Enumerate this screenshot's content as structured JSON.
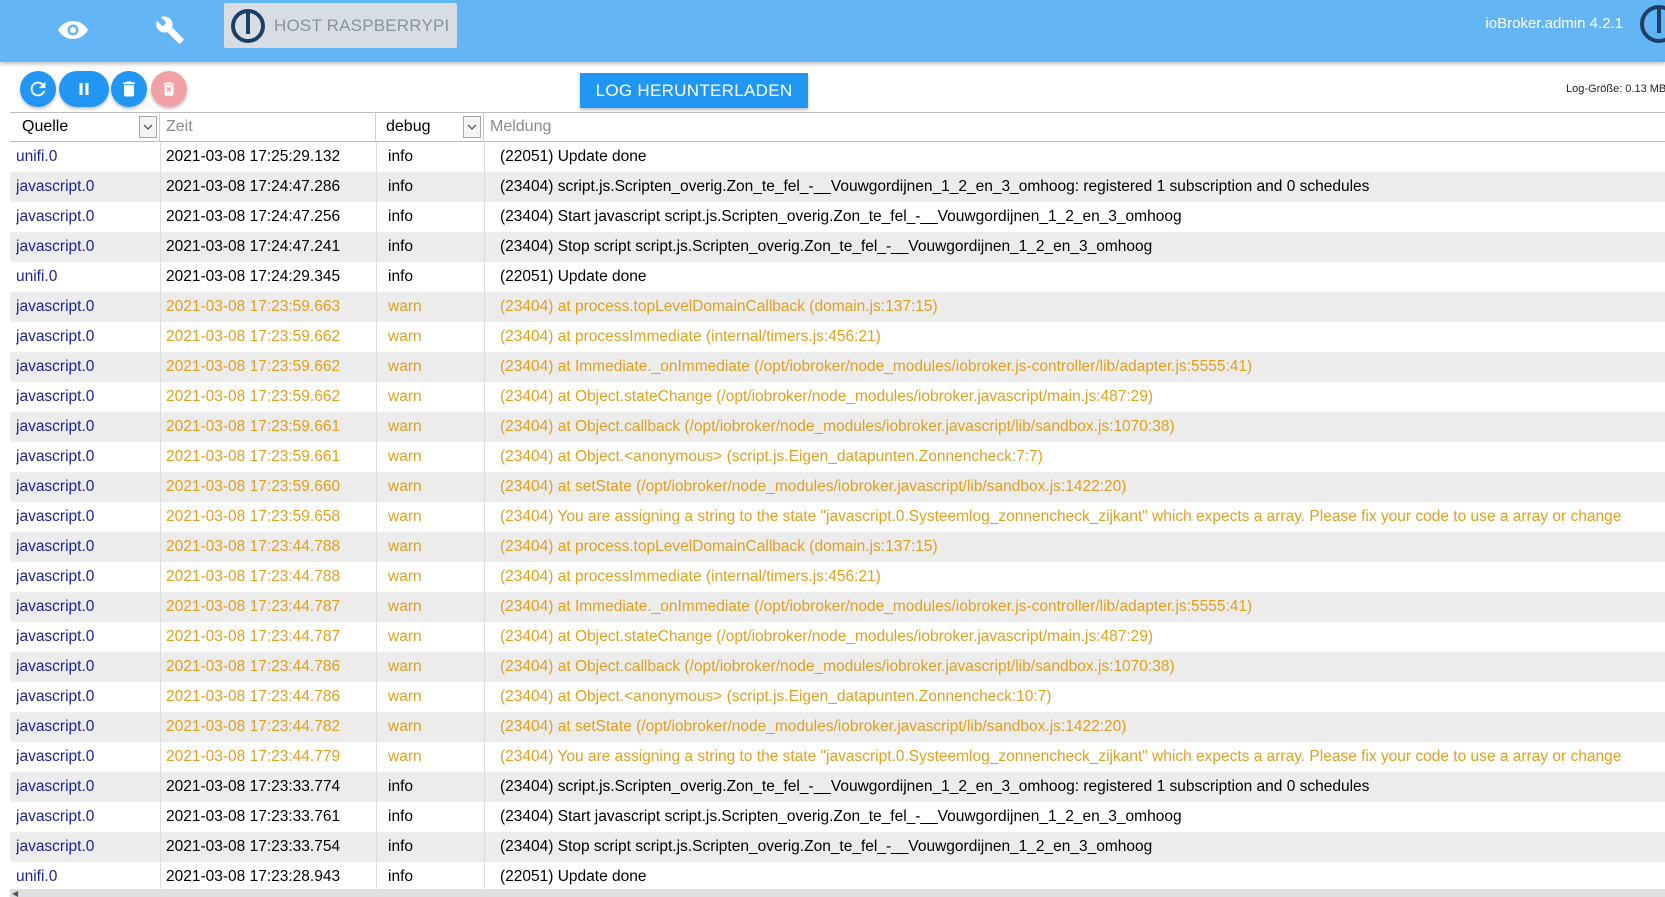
{
  "header": {
    "host_label": "HOST RASPBERRYPI",
    "version": "ioBroker.admin 4.2.1"
  },
  "toolbar": {
    "download_label": "LOG HERUNTERLADEN",
    "log_size": "Log-Größe: 0.13 MB"
  },
  "columns": {
    "source": "Quelle",
    "time": "Zeit",
    "severity": "debug",
    "message_placeholder": "Meldung"
  },
  "colors": {
    "topbar": "#64b5f6",
    "accent": "#2196f3",
    "warn": "#e0a020",
    "source_text": "#1b1f9a"
  },
  "rows": [
    {
      "source": "unifi.0",
      "time": "2021-03-08 17:25:29.132",
      "severity": "info",
      "message": "(22051) Update done"
    },
    {
      "source": "javascript.0",
      "time": "2021-03-08 17:24:47.286",
      "severity": "info",
      "message": "(23404) script.js.Scripten_overig.Zon_te_fel_-__Vouwgordijnen_1_2_en_3_omhoog: registered 1 subscription and 0 schedules"
    },
    {
      "source": "javascript.0",
      "time": "2021-03-08 17:24:47.256",
      "severity": "info",
      "message": "(23404) Start javascript script.js.Scripten_overig.Zon_te_fel_-__Vouwgordijnen_1_2_en_3_omhoog"
    },
    {
      "source": "javascript.0",
      "time": "2021-03-08 17:24:47.241",
      "severity": "info",
      "message": "(23404) Stop script script.js.Scripten_overig.Zon_te_fel_-__Vouwgordijnen_1_2_en_3_omhoog"
    },
    {
      "source": "unifi.0",
      "time": "2021-03-08 17:24:29.345",
      "severity": "info",
      "message": "(22051) Update done"
    },
    {
      "source": "javascript.0",
      "time": "2021-03-08 17:23:59.663",
      "severity": "warn",
      "message": "(23404) at process.topLevelDomainCallback (domain.js:137:15)"
    },
    {
      "source": "javascript.0",
      "time": "2021-03-08 17:23:59.662",
      "severity": "warn",
      "message": "(23404) at processImmediate (internal/timers.js:456:21)"
    },
    {
      "source": "javascript.0",
      "time": "2021-03-08 17:23:59.662",
      "severity": "warn",
      "message": "(23404) at Immediate._onImmediate (/opt/iobroker/node_modules/iobroker.js-controller/lib/adapter.js:5555:41)"
    },
    {
      "source": "javascript.0",
      "time": "2021-03-08 17:23:59.662",
      "severity": "warn",
      "message": "(23404) at Object.stateChange (/opt/iobroker/node_modules/iobroker.javascript/main.js:487:29)"
    },
    {
      "source": "javascript.0",
      "time": "2021-03-08 17:23:59.661",
      "severity": "warn",
      "message": "(23404) at Object.callback (/opt/iobroker/node_modules/iobroker.javascript/lib/sandbox.js:1070:38)"
    },
    {
      "source": "javascript.0",
      "time": "2021-03-08 17:23:59.661",
      "severity": "warn",
      "message": "(23404) at Object.<anonymous> (script.js.Eigen_datapunten.Zonnencheck:7:7)"
    },
    {
      "source": "javascript.0",
      "time": "2021-03-08 17:23:59.660",
      "severity": "warn",
      "message": "(23404) at setState (/opt/iobroker/node_modules/iobroker.javascript/lib/sandbox.js:1422:20)"
    },
    {
      "source": "javascript.0",
      "time": "2021-03-08 17:23:59.658",
      "severity": "warn",
      "message": "(23404) You are assigning a string to the state \"javascript.0.Systeemlog_zonnencheck_zijkant\" which expects a array. Please fix your code to use a array or change"
    },
    {
      "source": "javascript.0",
      "time": "2021-03-08 17:23:44.788",
      "severity": "warn",
      "message": "(23404) at process.topLevelDomainCallback (domain.js:137:15)"
    },
    {
      "source": "javascript.0",
      "time": "2021-03-08 17:23:44.788",
      "severity": "warn",
      "message": "(23404) at processImmediate (internal/timers.js:456:21)"
    },
    {
      "source": "javascript.0",
      "time": "2021-03-08 17:23:44.787",
      "severity": "warn",
      "message": "(23404) at Immediate._onImmediate (/opt/iobroker/node_modules/iobroker.js-controller/lib/adapter.js:5555:41)"
    },
    {
      "source": "javascript.0",
      "time": "2021-03-08 17:23:44.787",
      "severity": "warn",
      "message": "(23404) at Object.stateChange (/opt/iobroker/node_modules/iobroker.javascript/main.js:487:29)"
    },
    {
      "source": "javascript.0",
      "time": "2021-03-08 17:23:44.786",
      "severity": "warn",
      "message": "(23404) at Object.callback (/opt/iobroker/node_modules/iobroker.javascript/lib/sandbox.js:1070:38)"
    },
    {
      "source": "javascript.0",
      "time": "2021-03-08 17:23:44.786",
      "severity": "warn",
      "message": "(23404) at Object.<anonymous> (script.js.Eigen_datapunten.Zonnencheck:10:7)"
    },
    {
      "source": "javascript.0",
      "time": "2021-03-08 17:23:44.782",
      "severity": "warn",
      "message": "(23404) at setState (/opt/iobroker/node_modules/iobroker.javascript/lib/sandbox.js:1422:20)"
    },
    {
      "source": "javascript.0",
      "time": "2021-03-08 17:23:44.779",
      "severity": "warn",
      "message": "(23404) You are assigning a string to the state \"javascript.0.Systeemlog_zonnencheck_zijkant\" which expects a array. Please fix your code to use a array or change"
    },
    {
      "source": "javascript.0",
      "time": "2021-03-08 17:23:33.774",
      "severity": "info",
      "message": "(23404) script.js.Scripten_overig.Zon_te_fel_-__Vouwgordijnen_1_2_en_3_omhoog: registered 1 subscription and 0 schedules"
    },
    {
      "source": "javascript.0",
      "time": "2021-03-08 17:23:33.761",
      "severity": "info",
      "message": "(23404) Start javascript script.js.Scripten_overig.Zon_te_fel_-__Vouwgordijnen_1_2_en_3_omhoog"
    },
    {
      "source": "javascript.0",
      "time": "2021-03-08 17:23:33.754",
      "severity": "info",
      "message": "(23404) Stop script script.js.Scripten_overig.Zon_te_fel_-__Vouwgordijnen_1_2_en_3_omhoog"
    },
    {
      "source": "unifi.0",
      "time": "2021-03-08 17:23:28.943",
      "severity": "info",
      "message": "(22051) Update done"
    }
  ]
}
